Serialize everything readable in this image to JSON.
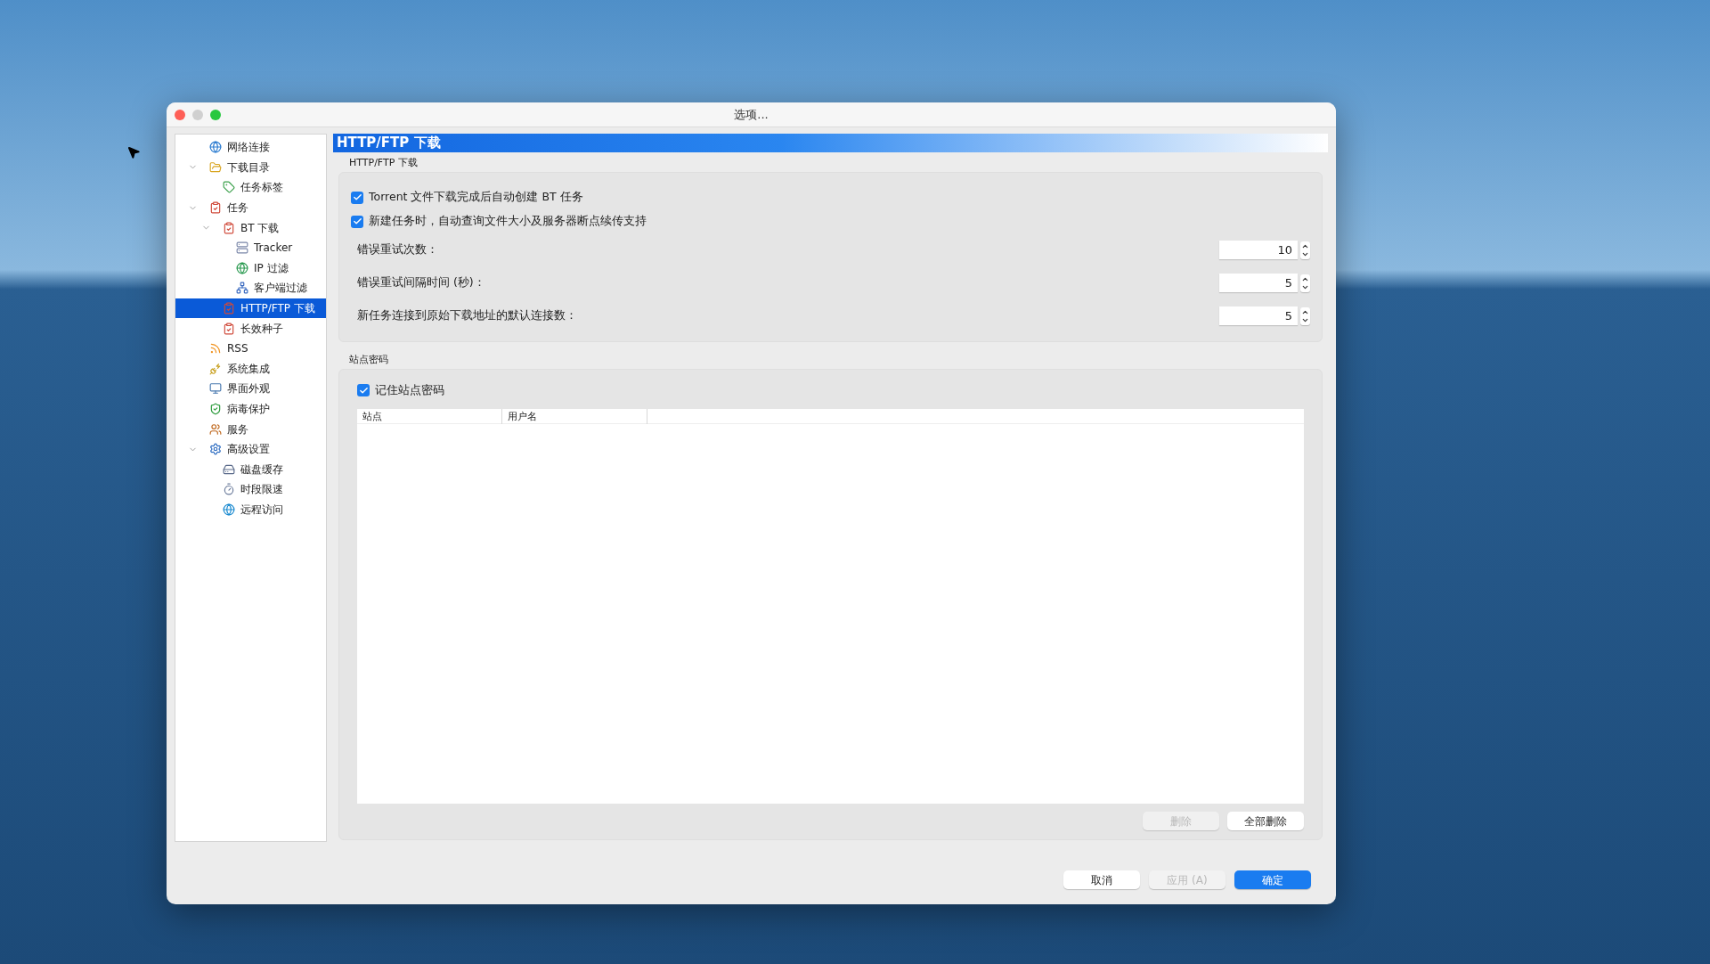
{
  "window": {
    "title": "选项..."
  },
  "sidebar": {
    "items": [
      {
        "label": "网络连接",
        "selected": false
      },
      {
        "label": "下载目录",
        "selected": false,
        "expanded": true,
        "children": [
          {
            "label": "任务标签",
            "selected": false
          }
        ]
      },
      {
        "label": "任务",
        "selected": false,
        "expanded": true,
        "children": [
          {
            "label": "BT 下载",
            "selected": false,
            "expanded": true,
            "children": [
              {
                "label": "Tracker",
                "selected": false
              },
              {
                "label": "IP 过滤",
                "selected": false
              },
              {
                "label": "客户端过滤",
                "selected": false
              }
            ]
          },
          {
            "label": "HTTP/FTP 下载",
            "selected": true
          },
          {
            "label": "长效种子",
            "selected": false
          }
        ]
      },
      {
        "label": "RSS",
        "selected": false
      },
      {
        "label": "系统集成",
        "selected": false
      },
      {
        "label": "界面外观",
        "selected": false
      },
      {
        "label": "病毒保护",
        "selected": false
      },
      {
        "label": "服务",
        "selected": false
      },
      {
        "label": "高级设置",
        "selected": false,
        "expanded": true,
        "children": [
          {
            "label": "磁盘缓存",
            "selected": false
          },
          {
            "label": "时段限速",
            "selected": false
          },
          {
            "label": "远程访问",
            "selected": false
          }
        ]
      }
    ]
  },
  "page_title": "HTTP/FTP 下载",
  "download_group": {
    "title": "HTTP/FTP 下载",
    "options": [
      {
        "label": "Torrent 文件下载完成后自动创建 BT 任务",
        "checked": true
      },
      {
        "label": "新建任务时，自动查询文件大小及服务器断点续传支持",
        "checked": true
      }
    ],
    "fields": [
      {
        "label": "错误重试次数：",
        "value": "10"
      },
      {
        "label": "错误重试间隔时间 (秒)：",
        "value": "5"
      },
      {
        "label": "新任务连接到原始下载地址的默认连接数：",
        "value": "5"
      }
    ]
  },
  "password_group": {
    "title": "站点密码",
    "remember": {
      "label": "记住站点密码",
      "checked": true
    },
    "table": {
      "columns": [
        "站点",
        "用户名"
      ]
    },
    "buttons": [
      {
        "label": "删除",
        "disabled": true
      },
      {
        "label": "全部删除",
        "disabled": false
      }
    ]
  },
  "footer_buttons": [
    {
      "label": "取消",
      "disabled": false,
      "kind": "normal"
    },
    {
      "label": "应用 (A)",
      "disabled": true,
      "kind": "normal"
    },
    {
      "label": "确定",
      "disabled": false,
      "kind": "primary"
    }
  ]
}
